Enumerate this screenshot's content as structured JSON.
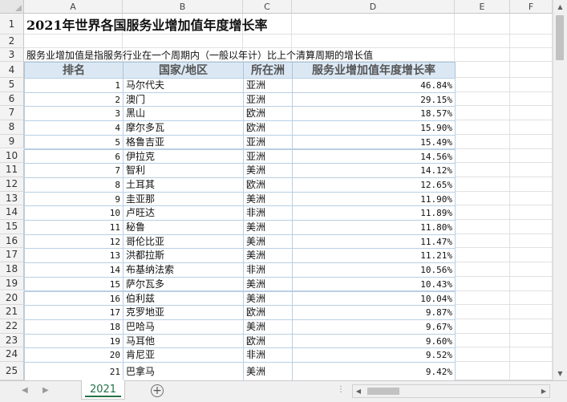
{
  "columns": [
    "A",
    "B",
    "C",
    "D",
    "E",
    "F"
  ],
  "rows_visible": [
    "1",
    "2",
    "3",
    "4",
    "5",
    "6",
    "7",
    "8",
    "9",
    "10",
    "11",
    "12",
    "13",
    "14",
    "15",
    "16",
    "17",
    "18",
    "19",
    "20",
    "21",
    "22",
    "23",
    "24",
    "25"
  ],
  "title": "2021年世界各国服务业增加值年度增长率",
  "note": "服务业增加值是指服务行业在一个周期内（一般以年计）比上个清算周期的增长值",
  "table": {
    "headers": [
      "排名",
      "国家/地区",
      "所在洲",
      "服务业增加值年度增长率"
    ],
    "rows": [
      [
        "1",
        "马尔代夫",
        "亚洲",
        "46.84%"
      ],
      [
        "2",
        "澳门",
        "亚洲",
        "29.15%"
      ],
      [
        "3",
        "黑山",
        "欧洲",
        "18.57%"
      ],
      [
        "4",
        "摩尔多瓦",
        "欧洲",
        "15.90%"
      ],
      [
        "5",
        "格鲁吉亚",
        "亚洲",
        "15.49%"
      ],
      [
        "6",
        "伊拉克",
        "亚洲",
        "14.56%"
      ],
      [
        "7",
        "智利",
        "美洲",
        "14.12%"
      ],
      [
        "8",
        "土耳其",
        "欧洲",
        "12.65%"
      ],
      [
        "9",
        "圭亚那",
        "美洲",
        "11.90%"
      ],
      [
        "10",
        "卢旺达",
        "非洲",
        "11.89%"
      ],
      [
        "11",
        "秘鲁",
        "美洲",
        "11.80%"
      ],
      [
        "12",
        "哥伦比亚",
        "美洲",
        "11.47%"
      ],
      [
        "13",
        "洪都拉斯",
        "美洲",
        "11.21%"
      ],
      [
        "14",
        "布基纳法索",
        "非洲",
        "10.56%"
      ],
      [
        "15",
        "萨尔瓦多",
        "美洲",
        "10.43%"
      ],
      [
        "16",
        "伯利兹",
        "美洲",
        "10.04%"
      ],
      [
        "17",
        "克罗地亚",
        "欧洲",
        "9.87%"
      ],
      [
        "18",
        "巴哈马",
        "美洲",
        "9.67%"
      ],
      [
        "19",
        "马耳他",
        "欧洲",
        "9.60%"
      ],
      [
        "20",
        "肯尼亚",
        "非洲",
        "9.52%"
      ],
      [
        "21",
        "巴拿马",
        "美洲",
        "9.42%"
      ]
    ]
  },
  "sheet_tab": "2021",
  "icons": {
    "add_sheet": "plus-circle-icon",
    "scroll_up": "arrow-up-icon",
    "scroll_down": "arrow-down-icon",
    "scroll_left": "arrow-left-icon",
    "scroll_right": "arrow-right-icon",
    "tab_prev": "chevron-left-icon",
    "tab_next": "chevron-right-icon"
  },
  "colors": {
    "header_fill": "#dbe8f4",
    "tab_accent": "#217346"
  }
}
